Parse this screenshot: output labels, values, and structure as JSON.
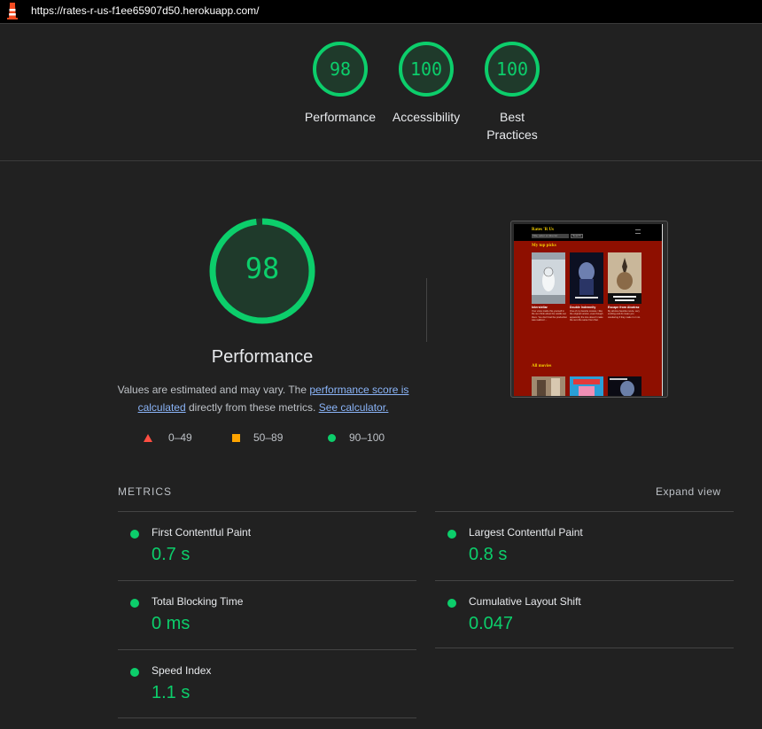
{
  "topbar": {
    "url": "https://rates-r-us-f1ee65907d50.herokuapp.com/"
  },
  "summary": [
    {
      "score": "98",
      "label": "Performance",
      "icon": "gauge-ring-icon"
    },
    {
      "score": "100",
      "label": "Accessibility",
      "icon": "gauge-ring-icon"
    },
    {
      "score": "100",
      "label": "Best Practices",
      "icon": "gauge-ring-icon"
    }
  ],
  "performance": {
    "score": "98",
    "title": "Performance",
    "desc_prefix": "Values are estimated and may vary. The ",
    "link_score": "performance score is calculated",
    "desc_mid": " directly from these metrics. ",
    "link_calc": "See calculator."
  },
  "legend": [
    {
      "range": "0–49",
      "color": "#ff4e42",
      "shape": "triangle"
    },
    {
      "range": "50–89",
      "color": "#ffa400",
      "shape": "square"
    },
    {
      "range": "90–100",
      "color": "#0cce6b",
      "shape": "circle"
    }
  ],
  "thumbnail": {
    "brand": "Rates 'R Us",
    "search_placeholder": "Title, actor or director",
    "search_button": "Search",
    "section_top": "My top picks",
    "section_all": "All movies",
    "movies": [
      {
        "title": "Interstellar",
        "desc": "Your voice inside this yourself in the sun think about the worlds out there. You don't feel the production was realized ..."
      },
      {
        "title": "Double Indemnity",
        "desc": "One of my favorite movies. I like the original version, even though apparently the lore doesn't make the sum the same from that."
      },
      {
        "title": "Escape from Alcatraz",
        "desc": "My all-time favorite movie, very exciting and do mean you wondering if they make it or not."
      }
    ]
  },
  "metrics": {
    "title": "METRICS",
    "expand_label": "Expand view",
    "items": [
      {
        "label": "First Contentful Paint",
        "value": "0.7 s"
      },
      {
        "label": "Largest Contentful Paint",
        "value": "0.8 s"
      },
      {
        "label": "Total Blocking Time",
        "value": "0 ms"
      },
      {
        "label": "Cumulative Layout Shift",
        "value": "0.047"
      },
      {
        "label": "Speed Index",
        "value": "1.1 s"
      }
    ]
  },
  "colors": {
    "pass": "#0cce6b",
    "link": "#8ab4f8",
    "background": "#212121"
  }
}
